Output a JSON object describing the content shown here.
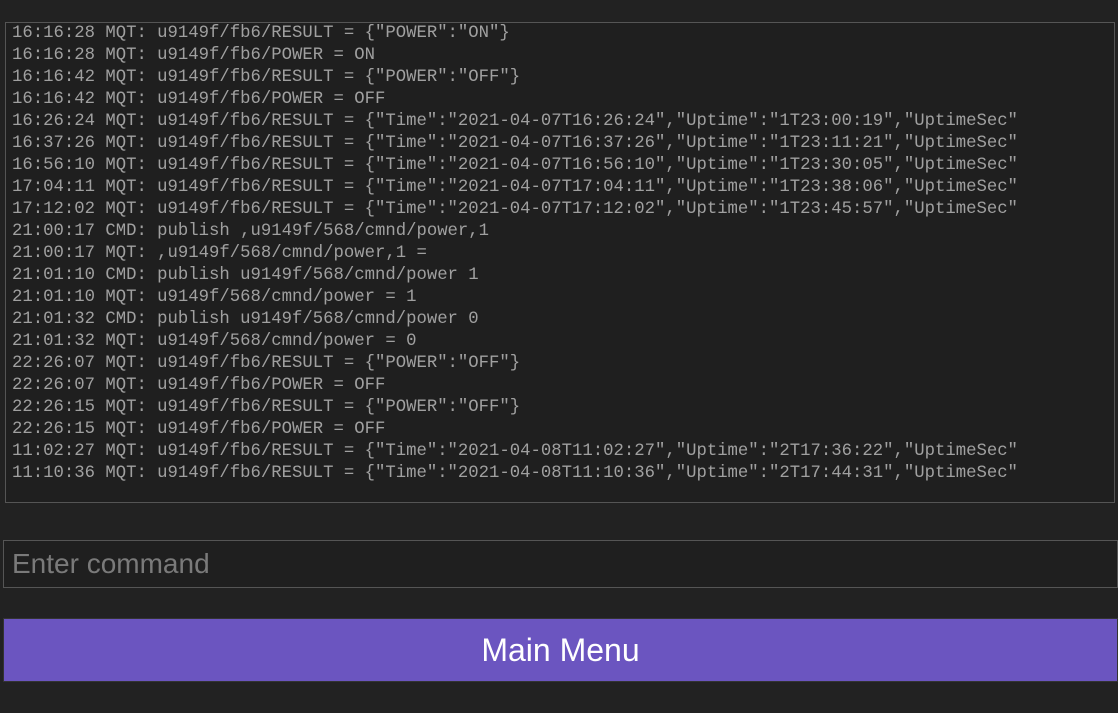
{
  "console": {
    "lines": [
      "16:16:28 MQT: u9149f/fb6/RESULT = {\"POWER\":\"ON\"}",
      "16:16:28 MQT: u9149f/fb6/POWER = ON",
      "16:16:42 MQT: u9149f/fb6/RESULT = {\"POWER\":\"OFF\"}",
      "16:16:42 MQT: u9149f/fb6/POWER = OFF",
      "16:26:24 MQT: u9149f/fb6/RESULT = {\"Time\":\"2021-04-07T16:26:24\",\"Uptime\":\"1T23:00:19\",\"UptimeSec\"",
      "16:37:26 MQT: u9149f/fb6/RESULT = {\"Time\":\"2021-04-07T16:37:26\",\"Uptime\":\"1T23:11:21\",\"UptimeSec\"",
      "16:56:10 MQT: u9149f/fb6/RESULT = {\"Time\":\"2021-04-07T16:56:10\",\"Uptime\":\"1T23:30:05\",\"UptimeSec\"",
      "17:04:11 MQT: u9149f/fb6/RESULT = {\"Time\":\"2021-04-07T17:04:11\",\"Uptime\":\"1T23:38:06\",\"UptimeSec\"",
      "17:12:02 MQT: u9149f/fb6/RESULT = {\"Time\":\"2021-04-07T17:12:02\",\"Uptime\":\"1T23:45:57\",\"UptimeSec\"",
      "21:00:17 CMD: publish ,u9149f/568/cmnd/power,1",
      "21:00:17 MQT: ,u9149f/568/cmnd/power,1 =",
      "21:01:10 CMD: publish u9149f/568/cmnd/power 1",
      "21:01:10 MQT: u9149f/568/cmnd/power = 1",
      "21:01:32 CMD: publish u9149f/568/cmnd/power 0",
      "21:01:32 MQT: u9149f/568/cmnd/power = 0",
      "22:26:07 MQT: u9149f/fb6/RESULT = {\"POWER\":\"OFF\"}",
      "22:26:07 MQT: u9149f/fb6/POWER = OFF",
      "22:26:15 MQT: u9149f/fb6/RESULT = {\"POWER\":\"OFF\"}",
      "22:26:15 MQT: u9149f/fb6/POWER = OFF",
      "11:02:27 MQT: u9149f/fb6/RESULT = {\"Time\":\"2021-04-08T11:02:27\",\"Uptime\":\"2T17:36:22\",\"UptimeSec\"",
      "11:10:36 MQT: u9149f/fb6/RESULT = {\"Time\":\"2021-04-08T11:10:36\",\"Uptime\":\"2T17:44:31\",\"UptimeSec\""
    ]
  },
  "input": {
    "placeholder": "Enter command",
    "value": ""
  },
  "buttons": {
    "main_menu": "Main Menu"
  },
  "colors": {
    "background": "#222222",
    "panel": "#1f1f1f",
    "border": "#555555",
    "text_muted": "#a0a0a0",
    "button_bg": "#6b55c0",
    "button_fg": "#ffffff"
  }
}
